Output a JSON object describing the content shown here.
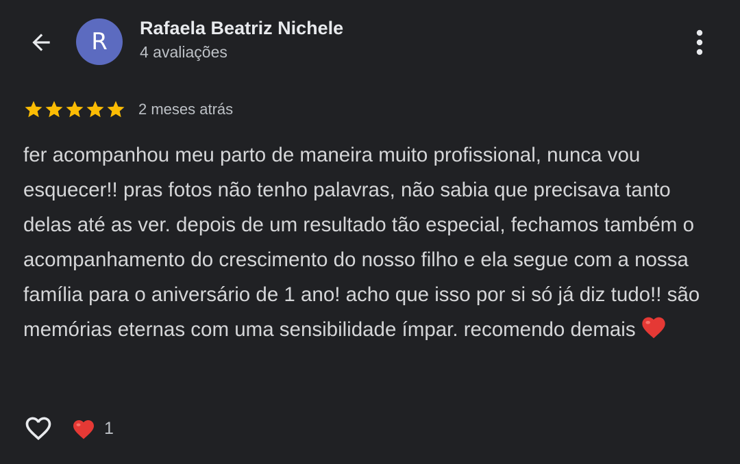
{
  "header": {
    "back_icon": "arrow-back-icon",
    "avatar_letter": "R",
    "avatar_color": "#5c6bc0",
    "reviewer_name": "Rafaela Beatriz Nichele",
    "reviews_count": "4 avaliações",
    "more_icon": "more-vertical-icon"
  },
  "review": {
    "rating": 5,
    "rating_max": 5,
    "star_color": "#fbbc04",
    "time_ago": "2 meses atrás",
    "text": "fer acompanhou meu parto de maneira muito profissional, nunca vou esquecer!! pras fotos não tenho palavras, não sabia que precisava tanto delas até as ver. depois de um resultado tão especial, fechamos também o acompanhamento do crescimento do nosso filho e ela segue com a nossa família para o aniversário de 1 ano! acho que isso por si só já diz tudo!! são memórias eternas com uma sensibilidade ímpar. recomendo demais",
    "emoji_icon": "red-heart-emoji-icon"
  },
  "actions": {
    "like_icon": "heart-outline-icon",
    "reaction_icon": "red-heart-icon",
    "reaction_count": "1"
  }
}
